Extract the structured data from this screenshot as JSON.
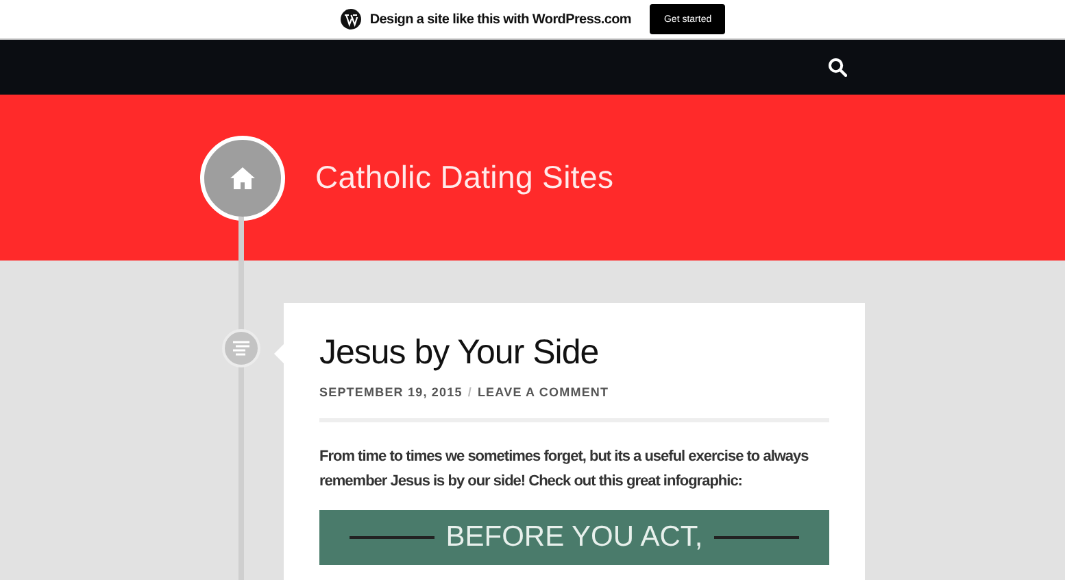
{
  "banner": {
    "text": "Design a site like this with WordPress.com",
    "button": "Get started"
  },
  "header": {
    "site_title": "Catholic Dating Sites"
  },
  "post": {
    "title": "Jesus by Your Side",
    "date": "SEPTEMBER 19, 2015",
    "separator": "/",
    "comment_link": "LEAVE A COMMENT",
    "body": "From time to times we sometimes forget, but its a useful exercise to always remember Jesus is by our side! Check out this great infographic:",
    "infographic": {
      "heading": "BEFORE YOU ACT,"
    }
  }
}
